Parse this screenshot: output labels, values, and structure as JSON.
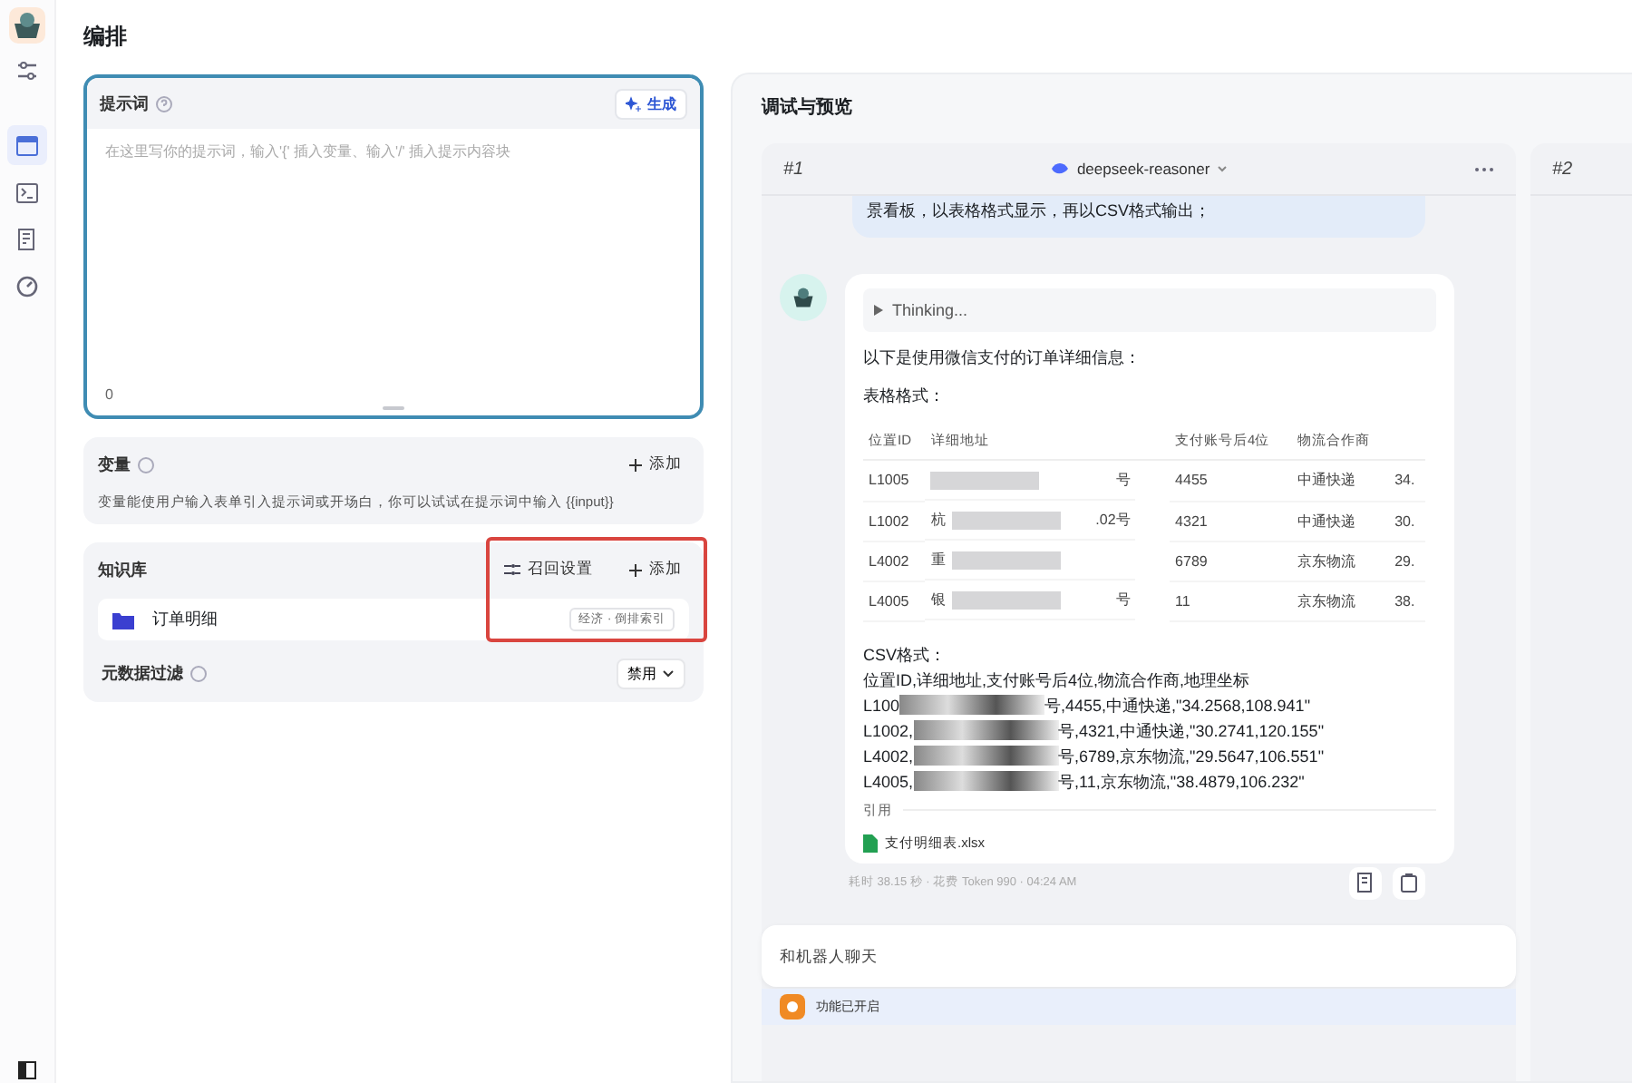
{
  "sidebar": {
    "nav_items": [
      {
        "kind": "window",
        "selected": true
      },
      {
        "kind": "terminal",
        "selected": false
      },
      {
        "kind": "document",
        "selected": false
      },
      {
        "kind": "gauge",
        "selected": false
      }
    ]
  },
  "page_title": "编排",
  "prompt": {
    "title": "提示词",
    "generate_button": "生成",
    "placeholder": "在这里写你的提示词，输入'{' 插入变量、输入'/' 插入提示内容块",
    "counter": "0"
  },
  "variables": {
    "title": "变量",
    "add_button": "添加",
    "description": "变量能使用户输入表单引入提示词或开场白，你可以试试在提示词中输入 {{input}}"
  },
  "knowledge": {
    "title": "知识库",
    "recall_button": "召回设置",
    "add_button": "添加",
    "highlighted": true,
    "items": [
      {
        "name": "订单明细",
        "tag": "经济 · 倒排索引"
      }
    ],
    "metadata_filter": {
      "label": "元数据过滤",
      "value": "禁用"
    }
  },
  "preview": {
    "title": "调试与预览",
    "panels": [
      {
        "label": "#1",
        "model": "deepseek-reasoner"
      },
      {
        "label": "#2"
      }
    ],
    "user_message": "景看板，以表格格式显示，再以CSV格式输出；",
    "reply": {
      "thinking": "Thinking...",
      "intro": "以下是使用微信支付的订单详细信息：",
      "table_heading": "表格格式：",
      "table": {
        "columns": [
          "位置ID",
          "详细地址",
          "支付账号后4位",
          "物流合作商",
          ""
        ],
        "rows": [
          {
            "id": "L1005",
            "address_before": "",
            "address_after": "号",
            "account": "4455",
            "carrier": "中通快递",
            "column_5": "34."
          },
          {
            "id": "L1002",
            "address_before": "杭",
            "address_after": ".02号",
            "account": "4321",
            "carrier": "中通快递",
            "column_5": "30."
          },
          {
            "id": "L4002",
            "address_before": "重",
            "address_after": "",
            "account": "6789",
            "carrier": "京东物流",
            "column_5": "29."
          },
          {
            "id": "L4005",
            "address_before": "银",
            "address_after": "号",
            "account": "11",
            "carrier": "京东物流",
            "column_5": "38."
          }
        ]
      },
      "csv_heading": "CSV格式：",
      "csv_header": "位置ID,详细地址,支付账号后4位,物流合作商,地理坐标",
      "csv_lines": [
        {
          "before": "L100",
          "after": "号,4455,中通快递,\"34.2568,108.941\""
        },
        {
          "before": "L1002,",
          "after": "号,4321,中通快递,\"30.2741,120.155\""
        },
        {
          "before": "L4002,",
          "after": "号,6789,京东物流,\"29.5647,106.551\""
        },
        {
          "before": "L4005,",
          "after": "号,11,京东物流,\"38.4879,106.232\""
        }
      ],
      "citation_label": "引用",
      "citation_file": "支付明细表.xlsx"
    },
    "meta": "耗时 38.15 秒 · 花费 Token 990 · 04:24 AM",
    "chat_placeholder": "和机器人聊天",
    "feature_status": "功能已开启"
  }
}
